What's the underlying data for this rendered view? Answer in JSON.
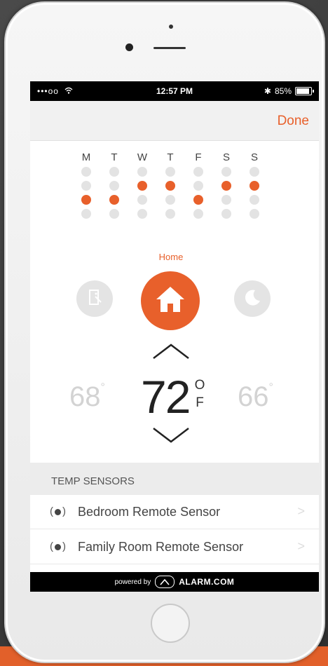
{
  "status_bar": {
    "signal": "•••oo",
    "time": "12:57 PM",
    "bluetooth": "✱",
    "battery_percent": "85%"
  },
  "nav": {
    "done_label": "Done"
  },
  "schedule": {
    "days": [
      "M",
      "T",
      "W",
      "T",
      "F",
      "S",
      "S"
    ],
    "active_slot_index": [
      2,
      2,
      1,
      1,
      2,
      1,
      1
    ]
  },
  "modes": {
    "active_label": "Home",
    "active": "home-icon"
  },
  "thermostat": {
    "left_temp": "68",
    "main_temp": "72",
    "right_temp": "66",
    "degree": "°",
    "unit_top": "O",
    "unit_bottom": "F"
  },
  "sensors": {
    "header": "TEMP SENSORS",
    "items": [
      {
        "name": "Bedroom Remote Sensor"
      },
      {
        "name": "Family Room Remote Sensor"
      }
    ]
  },
  "footer": {
    "powered_by": "powered by",
    "brand": "ALARM.COM"
  },
  "colors": {
    "accent": "#e8602b",
    "inactive_dot": "#e3e3e3"
  }
}
